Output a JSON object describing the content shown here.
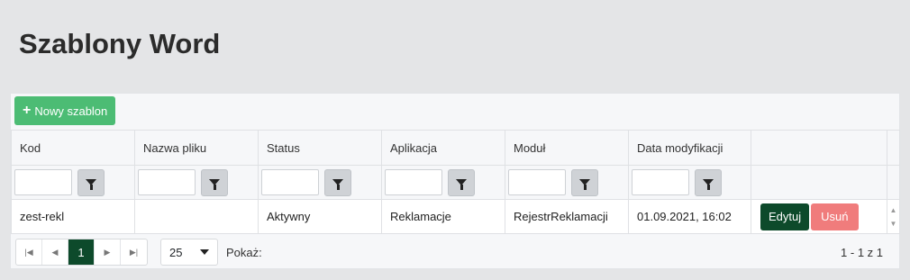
{
  "page": {
    "title": "Szablony Word"
  },
  "toolbar": {
    "new_label": "Nowy szablon",
    "new_icon": "plus-icon"
  },
  "grid": {
    "columns": [
      "Kod",
      "Nazwa pliku",
      "Status",
      "Aplikacja",
      "Moduł",
      "Data modyfikacji"
    ],
    "rows": [
      {
        "kod": "zest-rekl",
        "nazwa": "",
        "status": "Aktywny",
        "aplikacja": "Reklamacje",
        "modul": "RejestrReklamacji",
        "data": "01.09.2021, 16:02"
      }
    ],
    "actions": {
      "edit": "Edytuj",
      "delete": "Usuń"
    }
  },
  "pager": {
    "current_page": "1",
    "page_size": "25",
    "show_label": "Pokaż:",
    "range_info": "1 - 1 z 1"
  },
  "colors": {
    "primary": "#0d4a2b",
    "success": "#4cbc74",
    "danger": "#f07c7c"
  }
}
